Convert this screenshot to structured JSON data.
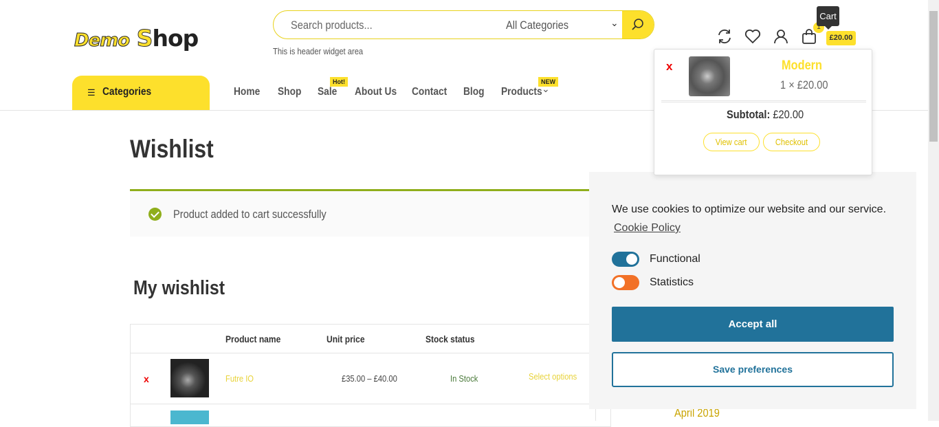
{
  "header": {
    "logo": {
      "first": "Demo",
      "s": "S",
      "rest": "hop"
    },
    "search": {
      "placeholder": "Search products...",
      "category": "All Categories"
    },
    "widget_text": "This is header widget area",
    "cart": {
      "count": "1",
      "price": "£20.00",
      "tooltip": "Cart"
    }
  },
  "nav": {
    "categories": "Categories",
    "items": [
      {
        "label": "Home"
      },
      {
        "label": "Shop"
      },
      {
        "label": "Sale",
        "badge": "Hot!"
      },
      {
        "label": "About Us"
      },
      {
        "label": "Contact"
      },
      {
        "label": "Blog"
      },
      {
        "label": "Products",
        "badge": "NEW"
      }
    ]
  },
  "page": {
    "title": "Wishlist",
    "notice": "Product added to cart successfully",
    "section_title": "My wishlist",
    "table": {
      "headers": [
        "Product name",
        "Unit price",
        "Stock status"
      ],
      "rows": [
        {
          "remove": "x",
          "name": "Futre IO",
          "price": "£35.00 – £40.00",
          "stock": "In Stock",
          "action": "Select options"
        }
      ]
    },
    "sidebar_date": "April 2019"
  },
  "cart_dropdown": {
    "remove": "x",
    "product_name": "Modern",
    "quantity": "1 × £20.00",
    "subtotal_label": "Subtotal:",
    "subtotal_value": "£20.00",
    "view_cart": "View cart",
    "checkout": "Checkout"
  },
  "cookie": {
    "text": "We use cookies to optimize our website and our service.",
    "policy_link": "Cookie Policy",
    "options": [
      {
        "label": "Functional",
        "on": true,
        "color": "#21729a"
      },
      {
        "label": "Statistics",
        "on": false,
        "color": "#f27127"
      }
    ],
    "accept": "Accept all",
    "save": "Save preferences"
  },
  "colors": {
    "accent": "#fde02c",
    "success": "#8fae1b",
    "cookie_primary": "#21729a"
  }
}
